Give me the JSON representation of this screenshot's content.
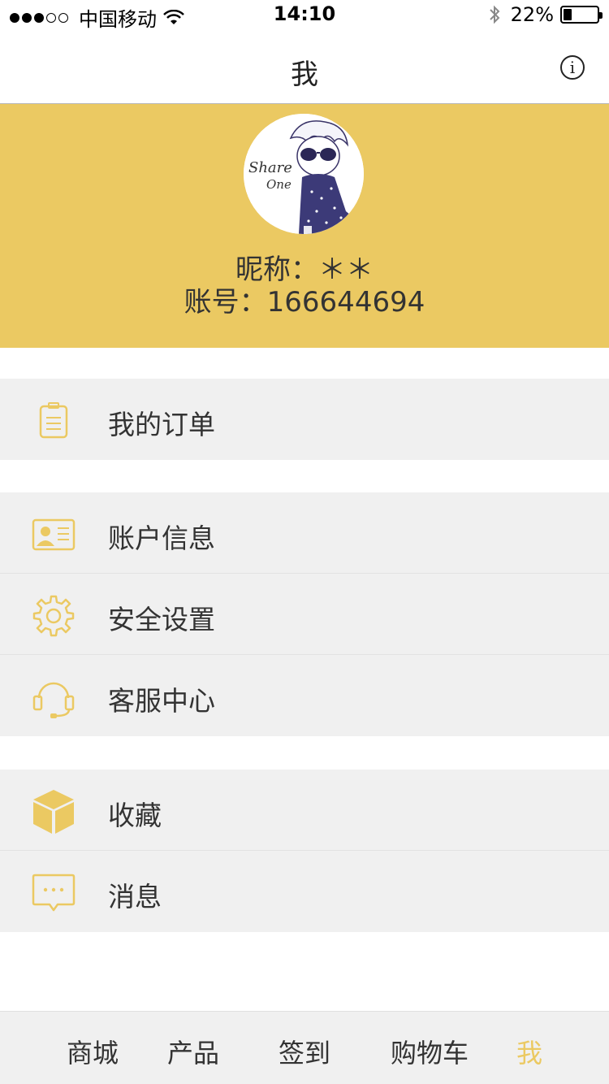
{
  "status_bar": {
    "carrier": "中国移动",
    "time": "14:10",
    "battery": "22%",
    "battery_level": 0.22,
    "signal_bars": 3
  },
  "nav": {
    "title": "我",
    "info_icon": "info-icon"
  },
  "profile": {
    "nickname": "昵称：＊＊",
    "account": "账号：166644694",
    "accent_color": "#ebc962",
    "avatar_text_1": "Share",
    "avatar_text_2": "One"
  },
  "menu": {
    "group1": [
      {
        "label": "我的订单",
        "icon": "clipboard-icon"
      }
    ],
    "group2": [
      {
        "label": "账户信息",
        "icon": "id-card-icon"
      },
      {
        "label": "安全设置",
        "icon": "gear-icon"
      },
      {
        "label": "客服中心",
        "icon": "headset-icon"
      }
    ],
    "group3": [
      {
        "label": "收藏",
        "icon": "box-icon"
      },
      {
        "label": "消息",
        "icon": "chat-bubble-icon"
      }
    ]
  },
  "tabs": [
    {
      "label": "商城",
      "active": false
    },
    {
      "label": "产品",
      "active": false
    },
    {
      "label": "签到",
      "active": false
    },
    {
      "label": "购物车",
      "active": false
    },
    {
      "label": "我",
      "active": true
    }
  ]
}
